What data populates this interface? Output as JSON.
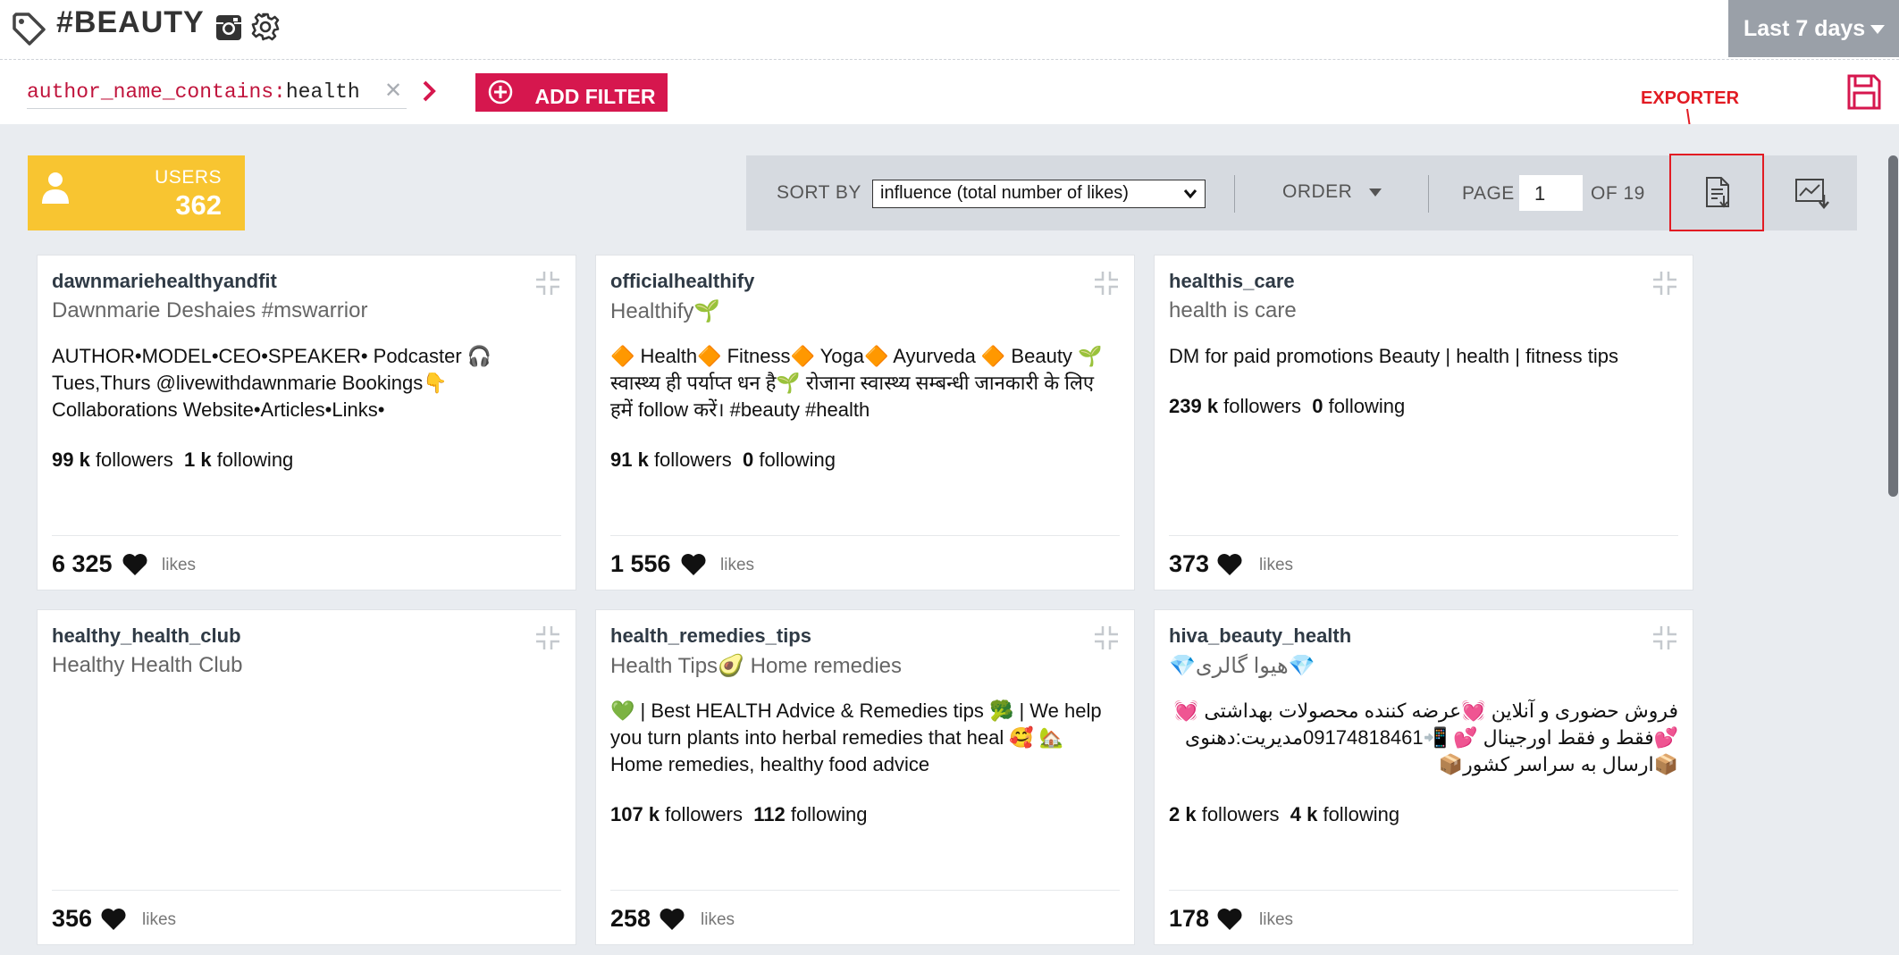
{
  "header": {
    "title": "#BEAUTY",
    "period": "Last 7 days"
  },
  "filter": {
    "key": "author_name_contains:",
    "value": "health",
    "add_label": "ADD FILTER"
  },
  "exporter_label": "EXPORTER",
  "users": {
    "label": "USERS",
    "count": "362"
  },
  "toolbar": {
    "sort_label": "SORT BY",
    "sort_value": "influence (total number of likes)",
    "order_label": "ORDER",
    "page_label": "PAGE",
    "page_value": "1",
    "of_label": "OF 19"
  },
  "colors": {
    "accent": "#d6174e",
    "users_bg": "#f8c531",
    "exporter": "#e21b23",
    "toolbar_bg": "#d6dae0",
    "main_bg": "#e9ecf0"
  },
  "likes_label": "likes",
  "cards": [
    {
      "username": "dawnmariehealthyandfit",
      "display_name": "Dawnmarie Deshaies #mswarrior",
      "bio": "AUTHOR•MODEL•CEO•SPEAKER• Podcaster 🎧 Tues,Thurs @livewithdawnmarie Bookings👇 Collaborations Website•Articles•Links•",
      "followers": "99 k",
      "following": "1 k",
      "likes": "6 325"
    },
    {
      "username": "officialhealthify",
      "display_name": "Healthify🌱",
      "bio": "🔶 Health🔶 Fitness🔶 Yoga🔶 Ayurveda 🔶 Beauty 🌱 स्वास्थ्य ही पर्याप्त धन है🌱 रोजाना स्वास्थ्य सम्बन्धी जानकारी के लिए हमें follow करें। #beauty #health",
      "followers": "91 k",
      "following": "0",
      "likes": "1 556"
    },
    {
      "username": "healthis_care",
      "display_name": "health is care",
      "bio": "DM for paid promotions Beauty | health | fitness tips",
      "followers": "239 k",
      "following": "0",
      "likes": "373"
    },
    {
      "username": "healthy_health_club",
      "display_name": "Healthy Health Club",
      "bio": "",
      "followers": "",
      "following": "",
      "likes": "356"
    },
    {
      "username": "health_remedies_tips",
      "display_name": "Health Tips🥑 Home remedies",
      "bio": "💚 | Best HEALTH Advice & Remedies tips 🥦 | We help you turn plants into herbal remedies that heal 🥰 🏡 Home remedies, healthy food advice",
      "followers": "107 k",
      "following": "112",
      "likes": "258"
    },
    {
      "username": "hiva_beauty_health",
      "display_name": "💎هیوا گالری💎",
      "bio": "فروش حضوری و آنلاین 💓عرضه کننده محصولات بهداشتی 💓 💕فقط و فقط اورجینال 💕 📲09174818461مدیریت:دهنوی 📦ارسال به سراسر کشور📦",
      "followers": "2 k",
      "following": "4 k",
      "likes": "178"
    }
  ]
}
